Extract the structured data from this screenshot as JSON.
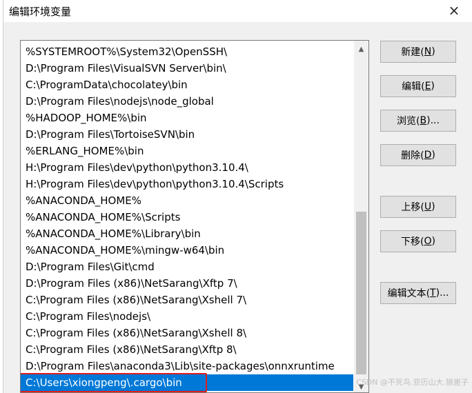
{
  "window": {
    "title": "编辑环境变量",
    "close_icon": "×"
  },
  "list": {
    "items": [
      "%SYSTEMROOT%\\System32\\OpenSSH\\",
      "D:\\Program Files\\VisualSVN Server\\bin\\",
      "C:\\ProgramData\\chocolatey\\bin",
      "D:\\Program Files\\nodejs\\node_global",
      "%HADOOP_HOME%\\bin",
      "D:\\Program Files\\TortoiseSVN\\bin",
      "%ERLANG_HOME%\\bin",
      "H:\\Program Files\\dev\\python\\python3.10.4\\",
      "H:\\Program Files\\dev\\python\\python3.10.4\\Scripts",
      "%ANACONDA_HOME%",
      "%ANACONDA_HOME%\\Scripts",
      "%ANACONDA_HOME%\\Library\\bin",
      "%ANACONDA_HOME%\\mingw-w64\\bin",
      "D:\\Program Files\\Git\\cmd",
      "D:\\Program Files (x86)\\NetSarang\\Xftp 7\\",
      "C:\\Program Files (x86)\\NetSarang\\Xshell 7\\",
      "C:\\Program Files\\nodejs\\",
      "C:\\Program Files (x86)\\NetSarang\\Xshell 8\\",
      "C:\\Program Files (x86)\\NetSarang\\Xftp 8\\",
      "D:\\Program Files\\anaconda3\\Lib\\site-packages\\onnxruntime",
      "C:\\Users\\xiongpeng\\.cargo\\bin"
    ],
    "selected_index": 20,
    "scroll_up_icon": "▲",
    "scroll_down_icon": "▼"
  },
  "buttons": {
    "new": {
      "label": "新建(",
      "key": "N",
      "end": ")"
    },
    "edit": {
      "label": "编辑(",
      "key": "E",
      "end": ")"
    },
    "browse": {
      "label": "浏览(",
      "key": "B",
      "end": ")..."
    },
    "delete": {
      "label": "删除(",
      "key": "D",
      "end": ")"
    },
    "move_up": {
      "label": "上移(",
      "key": "U",
      "end": ")"
    },
    "move_down": {
      "label": "下移(",
      "key": "O",
      "end": ")"
    },
    "edit_text": {
      "label": "编辑文本(",
      "key": "T",
      "end": ")..."
    }
  },
  "watermark": "CSDN @不死鸟.亚历山大.狼崽子",
  "colors": {
    "selection": "#0078d7",
    "highlight_box": "#e01e1e"
  }
}
